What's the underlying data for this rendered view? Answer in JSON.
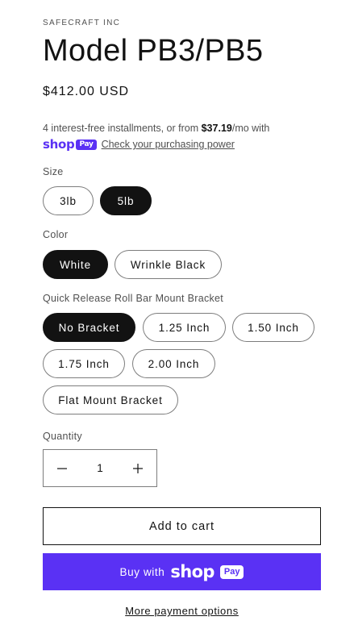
{
  "product": {
    "vendor": "SAFECRAFT INC",
    "title": "Model PB3/PB5",
    "price": "$412.00 USD"
  },
  "installments": {
    "text_before": "4 interest-free installments, or from ",
    "amount": "$37.19",
    "text_after": "/mo with",
    "shop_word": "shop",
    "pay_word": "Pay",
    "link_label": "Check your purchasing power"
  },
  "options": {
    "size": {
      "label": "Size",
      "values": [
        "3lb",
        "5lb"
      ],
      "selected": "5lb"
    },
    "color": {
      "label": "Color",
      "values": [
        "White",
        "Wrinkle Black"
      ],
      "selected": "White"
    },
    "bracket": {
      "label": "Quick Release Roll Bar Mount Bracket",
      "values": [
        "No Bracket",
        "1.25 Inch",
        "1.50 Inch",
        "1.75 Inch",
        "2.00 Inch",
        "Flat Mount Bracket"
      ],
      "selected": "No Bracket"
    }
  },
  "quantity": {
    "label": "Quantity",
    "value": "1",
    "minus_icon": "minus-icon",
    "plus_icon": "plus-icon"
  },
  "buttons": {
    "add_to_cart": "Add to cart",
    "buy_with": "Buy with",
    "buy_shop": "shop",
    "buy_pay": "Pay",
    "more_payment": "More payment options"
  },
  "colors": {
    "accent": "#5a31f4",
    "text": "#121212",
    "selected_bg": "#121212"
  }
}
